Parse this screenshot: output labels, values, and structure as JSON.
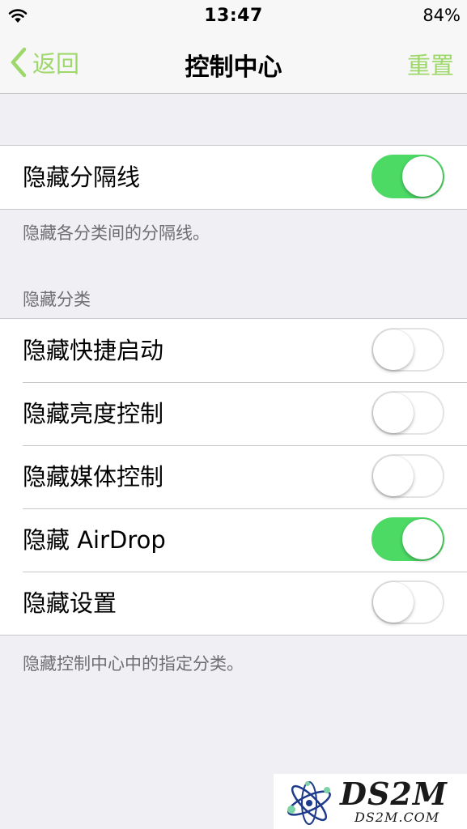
{
  "status_bar": {
    "time": "13:47",
    "battery": "84%",
    "wifi_icon": "wifi-icon"
  },
  "nav": {
    "back_label": "返回",
    "back_icon": "chevron-left-icon",
    "title": "控制中心",
    "reset_label": "重置",
    "accent_color": "#9ed86b"
  },
  "separator_group": {
    "rows": [
      {
        "label": "隐藏分隔线",
        "on": true
      }
    ],
    "footer": "隐藏各分类间的分隔线。"
  },
  "category_group": {
    "header": "隐藏分类",
    "rows": [
      {
        "label": "隐藏快捷启动",
        "on": false
      },
      {
        "label": "隐藏亮度控制",
        "on": false
      },
      {
        "label": "隐藏媒体控制",
        "on": false
      },
      {
        "label": "隐藏 AirDrop",
        "on": true
      },
      {
        "label": "隐藏设置",
        "on": false
      }
    ],
    "footer": "隐藏控制中心中的指定分类。"
  },
  "colors": {
    "switch_on": "#4cd964",
    "background": "#efeff4"
  },
  "watermark": {
    "title": "DS2M",
    "subtitle": "DS2M.COM"
  }
}
